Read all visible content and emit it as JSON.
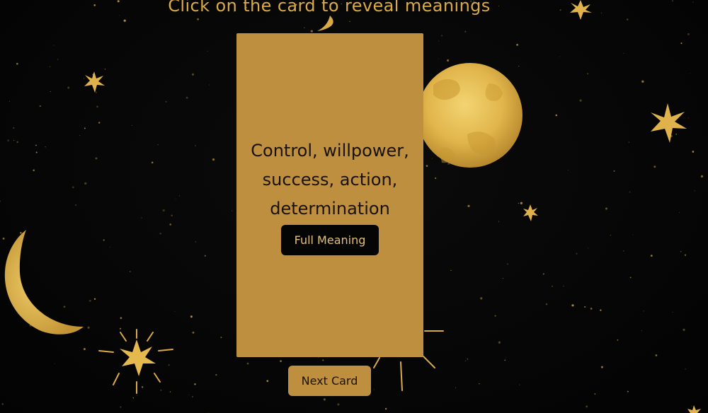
{
  "instruction": "Click on the card to reveal meanings",
  "card": {
    "meaning_lines": [
      "Control, willpower,",
      "success, action,",
      "determination"
    ],
    "full_meaning_label": "Full Meaning"
  },
  "next_card_label": "Next Card",
  "colors": {
    "background": "#050505",
    "gold": "#d9aa45",
    "card": "#bd8f3e",
    "card_text": "#1a1208",
    "button_dark": "#050505"
  },
  "decor": {
    "icons": [
      "moon-icon",
      "crescent-moon-icon",
      "star-icon"
    ]
  }
}
